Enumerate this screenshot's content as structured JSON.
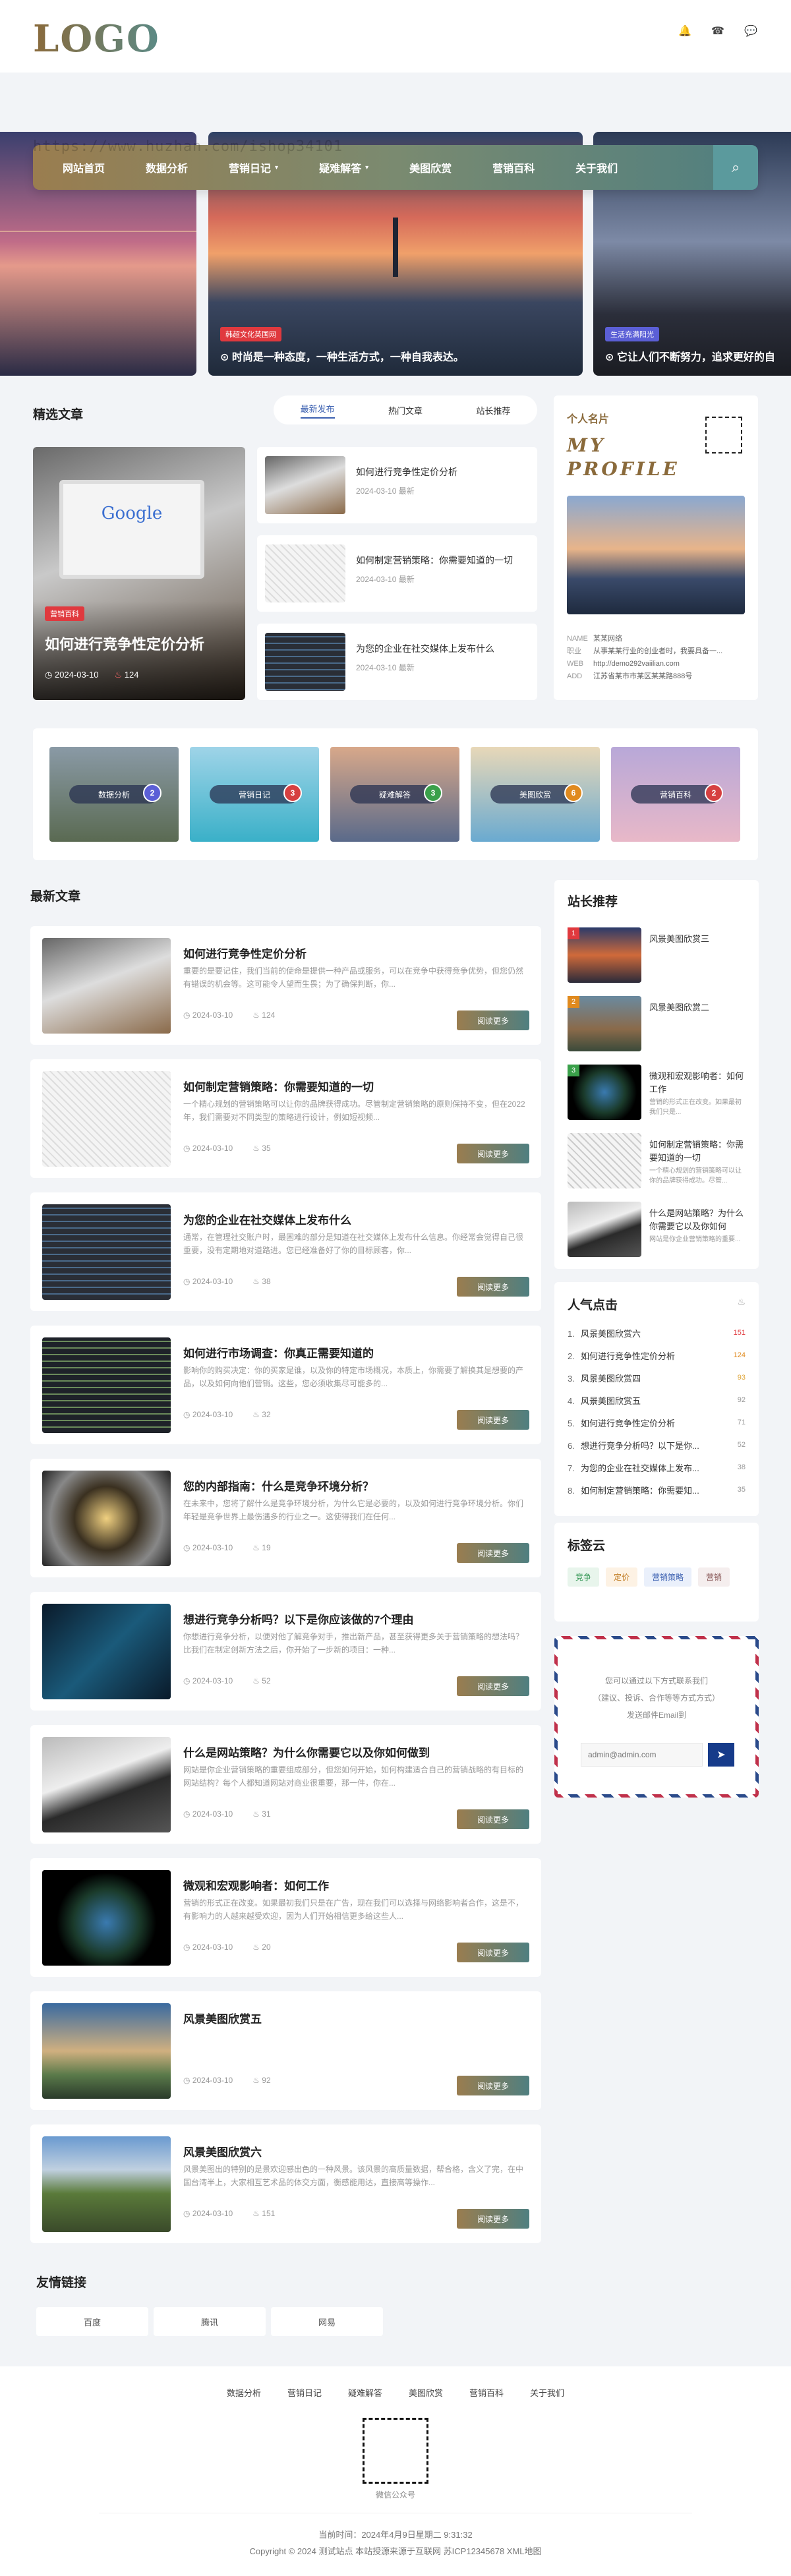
{
  "header": {
    "logo": "LOGO",
    "watermark": "https://www.huzhan.com/ishop34101",
    "icons": [
      "bell-icon",
      "phone-icon",
      "wechat-icon"
    ]
  },
  "nav": {
    "items": [
      {
        "label": "网站首页"
      },
      {
        "label": "数据分析"
      },
      {
        "label": "营销日记",
        "dropdown": true
      },
      {
        "label": "疑难解答",
        "dropdown": true
      },
      {
        "label": "美图欣赏"
      },
      {
        "label": "营销百科"
      },
      {
        "label": "关于我们"
      }
    ]
  },
  "slider": [
    {
      "tag": "",
      "title": ""
    },
    {
      "tag": "韩超文化英国网",
      "title": "时尚是一种态度，一种生活方式，一种自我表达。"
    },
    {
      "tag": "生活充满阳光",
      "title": "它让人们不断努力，追求更好的自"
    }
  ],
  "featured": {
    "title": "精选文章",
    "tabs": [
      "最新发布",
      "热门文章",
      "站长推荐"
    ],
    "main": {
      "tag": "营销百科",
      "title": "如何进行竞争性定价分析",
      "date": "2024-03-10",
      "views": "124"
    },
    "list": [
      {
        "title": "如何进行竞争性定价分析",
        "date": "2024-03-10",
        "suffix": "最新"
      },
      {
        "title": "如何制定营销策略：你需要知道的一切",
        "date": "2024-03-10",
        "suffix": "最新"
      },
      {
        "title": "为您的企业在社交媒体上发布什么",
        "date": "2024-03-10",
        "suffix": "最新"
      }
    ]
  },
  "profile": {
    "title": "个人名片",
    "heading": "MY PROFILE",
    "rows": [
      {
        "k": "NAME",
        "v": "某某网络"
      },
      {
        "k": "职业",
        "v": "从事某某行业的创业者时，我要具备一..."
      },
      {
        "k": "WEB",
        "v": "http://demo292vaiilian.com"
      },
      {
        "k": "ADD",
        "v": "江苏省某市市某区某某路888号"
      }
    ]
  },
  "categories": [
    {
      "label": "数据分析",
      "count": "2",
      "color": "#5b5fd6"
    },
    {
      "label": "营销日记",
      "count": "3",
      "color": "#d64040"
    },
    {
      "label": "疑难解答",
      "count": "3",
      "color": "#3aa04a"
    },
    {
      "label": "美图欣赏",
      "count": "6",
      "color": "#e08a1e"
    },
    {
      "label": "营销百科",
      "count": "2",
      "color": "#d64040"
    }
  ],
  "latest": {
    "title": "最新文章",
    "more_label": "阅读更多",
    "articles": [
      {
        "title": "如何进行竞争性定价分析",
        "desc": "重要的是要记住，我们当前的使命是提供一种产品或服务，可以在竞争中获得竞争优势，但您仍然有错误的机会等。这可能令人望而生畏；为了确保判断，你...",
        "date": "2024-03-10",
        "views": "124"
      },
      {
        "title": "如何制定营销策略：你需要知道的一切",
        "desc": "一个精心规划的营销策略可以让你的品牌获得成功。尽管制定营销策略的原则保持不变，但在2022年，我们需要对不同类型的策略进行设计，例如短视频...",
        "date": "2024-03-10",
        "views": "35"
      },
      {
        "title": "为您的企业在社交媒体上发布什么",
        "desc": "通常，在管理社交账户时，最困难的部分是知道在社交媒体上发布什么信息。你经常会觉得自己很重要，没有定期地对道路进。您已经准备好了你的目标顾客，你...",
        "date": "2024-03-10",
        "views": "38"
      },
      {
        "title": "如何进行市场调查：你真正需要知道的",
        "desc": "影响你的购买决定：你的买家是谁，以及你的特定市场概况，本质上，你需要了解换其是想要的产品，以及如何向他们营销。这些，您必须收集尽可能多的...",
        "date": "2024-03-10",
        "views": "32"
      },
      {
        "title": "您的内部指南：什么是竞争环境分析？",
        "desc": "在未来中，您将了解什么是竞争环境分析，为什么它是必要的，以及如何进行竞争环境分析。你们年轻是竞争世界上最伤遇多的行业之一。这使得我们在任何...",
        "date": "2024-03-10",
        "views": "19"
      },
      {
        "title": "想进行竞争分析吗？以下是你应该做的7个理由",
        "desc": "你想进行竞争分析，以便对他了解竞争对手，推出新产品，甚至获得更多关于营销策略的想法吗？比我们在制定创新方法之后，你开始了一步新的项目：一种...",
        "date": "2024-03-10",
        "views": "52"
      },
      {
        "title": "什么是网站策略？为什么你需要它以及你如何做到",
        "desc": "网站是你企业营销策略的重要组成部分，但您如何开始，如何构建适合自己的营销战略的有目标的网站结构？每个人都知道网站对商业很重要，那一件，你在...",
        "date": "2024-03-10",
        "views": "31"
      },
      {
        "title": "微观和宏观影响者：如何工作",
        "desc": "营销的形式正在改变。如果最初我们只是在广告，现在我们可以选择与网络影响者合作，这是不，有影响力的人越来越受欢迎，因为人们开始相信更多给这些人...",
        "date": "2024-03-10",
        "views": "20"
      },
      {
        "title": "风景美图欣赏五",
        "desc": "",
        "date": "2024-03-10",
        "views": "92"
      },
      {
        "title": "风景美图欣赏六",
        "desc": "风景美图出的特别的是景欢迎感出色的一种风景。该风景的高质量数据，帮合格，含义了完，在中国台湾半上，大家相互艺术品的体交方面，衡感能用达，直接高等操作...",
        "date": "2024-03-10",
        "views": "151"
      }
    ]
  },
  "recommend": {
    "title": "站长推荐",
    "items": [
      {
        "title": "风景美图欣赏三",
        "desc": "",
        "badge": "1"
      },
      {
        "title": "风景美图欣赏二",
        "desc": "",
        "badge": "2"
      },
      {
        "title": "微观和宏观影响者：如何工作",
        "desc": "营销的形式正在改变。如果最初我们只是...",
        "badge": "3"
      },
      {
        "title": "如何制定营销策略：你需要知道的一切",
        "desc": "一个精心规划的营销策略可以让你的品牌获得成功。尽管...",
        "badge": ""
      },
      {
        "title": "什么是网站策略？为什么你需要它以及你如何",
        "desc": "网站是你企业营销策略的重要...",
        "badge": ""
      }
    ]
  },
  "popular": {
    "title": "人气点击",
    "items": [
      {
        "title": "风景美图欣赏六",
        "count": "151"
      },
      {
        "title": "如何进行竞争性定价分析",
        "count": "124"
      },
      {
        "title": "风景美图欣赏四",
        "count": "93"
      },
      {
        "title": "风景美图欣赏五",
        "count": "92"
      },
      {
        "title": "如何进行竞争性定价分析",
        "count": "71"
      },
      {
        "title": "想进行竞争分析吗？以下是你...",
        "count": "52"
      },
      {
        "title": "为您的企业在社交媒体上发布...",
        "count": "38"
      },
      {
        "title": "如何制定营销策略：你需要知...",
        "count": "35"
      }
    ]
  },
  "tags": {
    "title": "标签云",
    "items": [
      "竞争",
      "定价",
      "营销策略",
      "营销"
    ]
  },
  "subscribe": {
    "line1": "您可以通过以下方式联系我们",
    "line2": "（建议、投诉、合作等等方式方式）",
    "line3": "发送邮件Email到",
    "placeholder": "admin@admin.com"
  },
  "links": {
    "title": "友情链接",
    "items": [
      "百度",
      "腾讯",
      "网易"
    ]
  },
  "footer": {
    "nav": [
      "数据分析",
      "营销日记",
      "疑难解答",
      "美图欣赏",
      "营销百科",
      "关于我们"
    ],
    "qr_label": "微信公众号",
    "time": "当前时间：2024年4月9日星期二 9:31:32",
    "copyright": "Copyright © 2024 测试站点 本站授源来源于互联网 苏ICP12345678 XML地图"
  }
}
